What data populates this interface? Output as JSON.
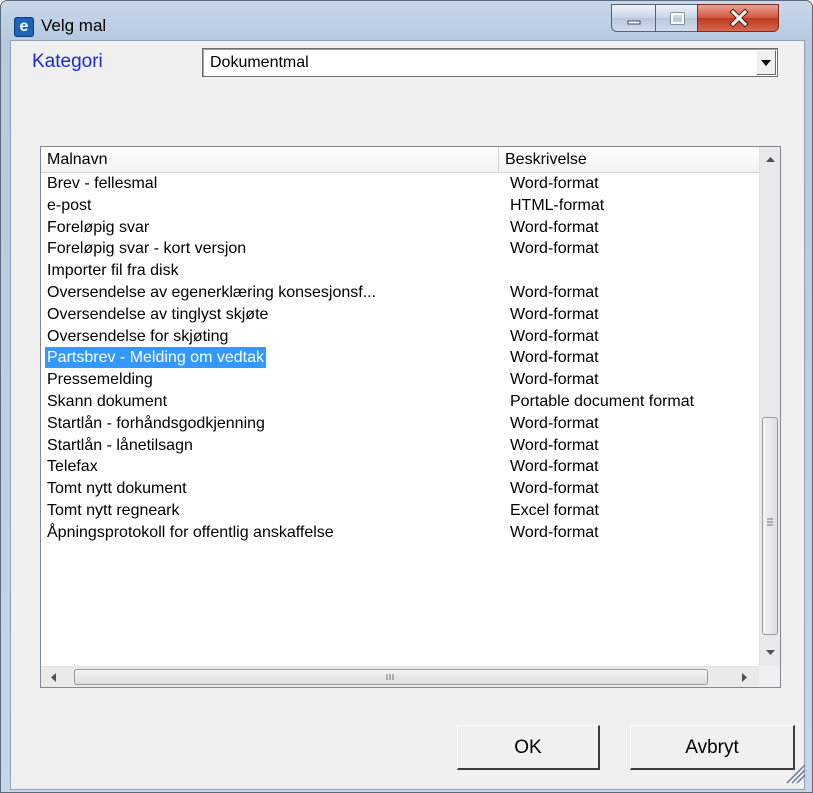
{
  "window": {
    "title": "Velg mal",
    "icon": "e-app-icon"
  },
  "kategori": {
    "label": "Kategori",
    "value": "Dokumentmal"
  },
  "list": {
    "columns": [
      "Malnavn",
      "Beskrivelse"
    ],
    "rows": [
      {
        "name": "Brev - fellesmal",
        "desc": "Word-format"
      },
      {
        "name": "e-post",
        "desc": "HTML-format"
      },
      {
        "name": "Foreløpig svar",
        "desc": "Word-format"
      },
      {
        "name": "Foreløpig svar - kort versjon",
        "desc": "Word-format"
      },
      {
        "name": "Importer fil fra disk",
        "desc": ""
      },
      {
        "name": "Oversendelse av egenerklæring konsesjonsf...",
        "desc": "Word-format"
      },
      {
        "name": "Oversendelse av tinglyst skjøte",
        "desc": "Word-format"
      },
      {
        "name": "Oversendelse for skjøting",
        "desc": "Word-format"
      },
      {
        "name": "Partsbrev - Melding om vedtak",
        "desc": "Word-format",
        "selected": true
      },
      {
        "name": "Pressemelding",
        "desc": "Word-format"
      },
      {
        "name": "Skann dokument",
        "desc": "Portable document format"
      },
      {
        "name": "Startlån - forhåndsgodkjenning",
        "desc": "Word-format"
      },
      {
        "name": "Startlån - lånetilsagn",
        "desc": "Word-format"
      },
      {
        "name": "Telefax",
        "desc": "Word-format"
      },
      {
        "name": "Tomt nytt dokument",
        "desc": "Word-format"
      },
      {
        "name": "Tomt nytt regneark",
        "desc": "Excel format"
      },
      {
        "name": "Åpningsprotokoll for offentlig anskaffelse",
        "desc": "Word-format"
      }
    ]
  },
  "buttons": {
    "ok": "OK",
    "cancel": "Avbryt"
  },
  "colors": {
    "selection": "#3399ff",
    "label_blue": "#1a2bd1",
    "close_red": "#c8452c"
  }
}
